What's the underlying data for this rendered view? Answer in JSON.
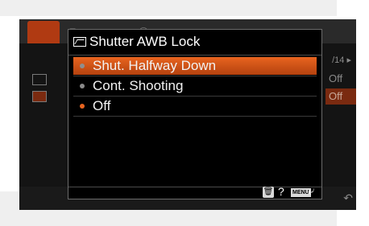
{
  "dialog": {
    "title": "Shutter AWB Lock",
    "options": [
      {
        "label": "Shut. Halfway Down",
        "selected": true
      },
      {
        "label": "Cont. Shooting",
        "selected": false
      },
      {
        "label": "Off",
        "selected": false
      }
    ],
    "footer": {
      "help": "?",
      "menu": "MENU"
    }
  },
  "background_menu": {
    "page": "/14 ▸",
    "rows": [
      "Off",
      "Off"
    ]
  },
  "colors": {
    "accent": "#e8641f",
    "accent_dark": "#b4420f"
  }
}
